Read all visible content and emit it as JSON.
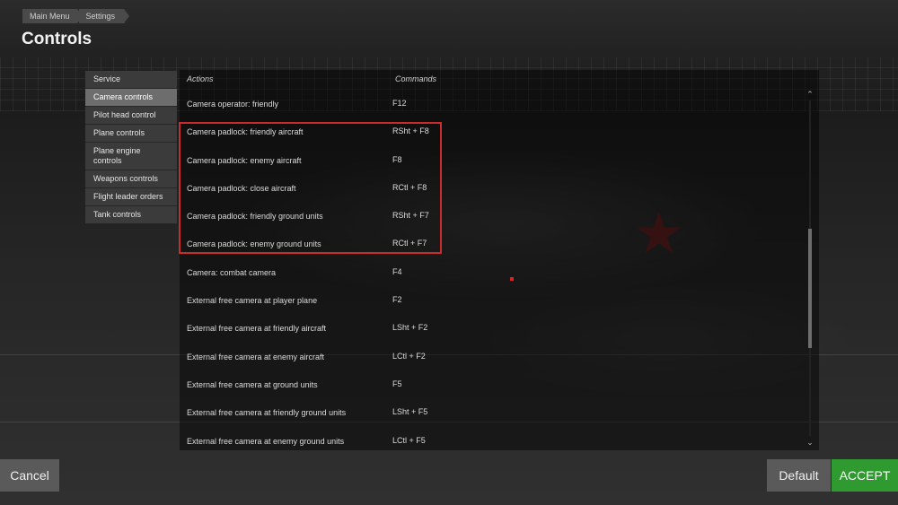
{
  "breadcrumb": [
    "Main Menu",
    "Settings"
  ],
  "page_title": "Controls",
  "sidebar": {
    "items": [
      {
        "label": "Service"
      },
      {
        "label": "Camera controls"
      },
      {
        "label": "Pilot head control"
      },
      {
        "label": "Plane controls"
      },
      {
        "label": "Plane engine controls"
      },
      {
        "label": "Weapons controls"
      },
      {
        "label": "Flight leader orders"
      },
      {
        "label": "Tank controls"
      }
    ],
    "active_index": 1
  },
  "table": {
    "headers": {
      "actions": "Actions",
      "commands": "Commands"
    },
    "rows": [
      {
        "action": "Camera operator: friendly",
        "command": "F12"
      },
      {
        "action": "Camera padlock: friendly aircraft",
        "command": "RSht + F8"
      },
      {
        "action": "Camera padlock: enemy aircraft",
        "command": "F8"
      },
      {
        "action": "Camera padlock: close aircraft",
        "command": "RCtl + F8"
      },
      {
        "action": "Camera padlock: friendly ground units",
        "command": "RSht + F7"
      },
      {
        "action": "Camera padlock: enemy ground units",
        "command": "RCtl + F7"
      },
      {
        "action": "Camera: combat camera",
        "command": "F4"
      },
      {
        "action": "External free camera at player plane",
        "command": "F2"
      },
      {
        "action": "External free camera at friendly aircraft",
        "command": "LSht + F2"
      },
      {
        "action": "External free camera at enemy aircraft",
        "command": "LCtl + F2"
      },
      {
        "action": "External free camera at ground units",
        "command": "F5"
      },
      {
        "action": "External free camera at friendly ground units",
        "command": "LSht + F5"
      },
      {
        "action": "External free camera at enemy ground units",
        "command": "LCtl + F5"
      }
    ]
  },
  "buttons": {
    "cancel": "Cancel",
    "default": "Default",
    "accept": "ACCEPT"
  },
  "icons": {
    "scroll_up": "chevron-up-icon",
    "scroll_down": "chevron-down-icon",
    "star": "red-star-icon"
  },
  "colors": {
    "accept": "#2f9a2f",
    "highlight": "#cc2b2b",
    "active_item": "#6d6d6d"
  }
}
